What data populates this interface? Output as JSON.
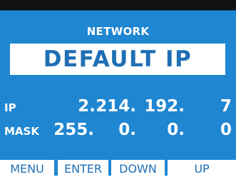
{
  "screen": {
    "section_title": "NETWORK",
    "mode": "DEFAULT IP"
  },
  "fields": {
    "ip": {
      "label": "IP",
      "octets": [
        "2.",
        "214.",
        "192.",
        "7"
      ]
    },
    "mask": {
      "label": "MASK",
      "octets": [
        "255.",
        "0.",
        "0.",
        "0"
      ]
    }
  },
  "softkeys": {
    "menu": "MENU",
    "enter": "ENTER",
    "down": "DOWN",
    "up": "UP"
  },
  "colors": {
    "screen_background": "#1f86d1",
    "accent_text": "#1f6fb5",
    "text_light": "#ffffff",
    "frame": "#111111"
  }
}
